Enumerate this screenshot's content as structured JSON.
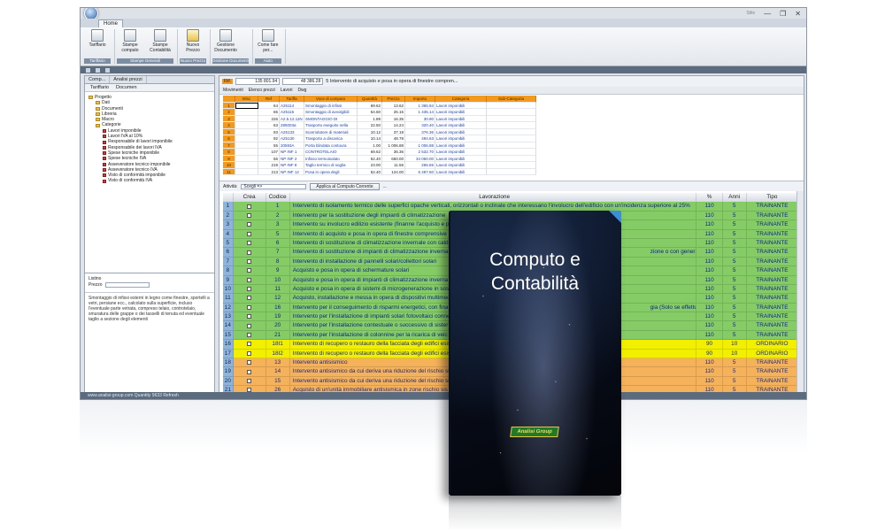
{
  "window": {
    "menu_label": "Stile",
    "minimize": "—",
    "restore": "❐",
    "close": "✕"
  },
  "ribbon": {
    "tab": "Home",
    "groups": [
      {
        "label": "Tariffario",
        "buttons": [
          "Tariffario"
        ]
      },
      {
        "label": "Stampe Generali",
        "buttons": [
          "Stampe computo",
          "Stampe Contabilità"
        ]
      },
      {
        "label": "Nuovo Prezzo",
        "buttons": [
          "Nuovo Prezzo"
        ]
      },
      {
        "label": "Gestione Documenti",
        "buttons": [
          "Gestione Documento"
        ]
      },
      {
        "label": "Aiuto",
        "buttons": [
          "Come fare per..."
        ]
      }
    ]
  },
  "left_panel": {
    "tabs": [
      "Comp...",
      "Analisi prezzi"
    ],
    "subtabs": [
      "Tariffario",
      "Documen"
    ],
    "tree": [
      {
        "label": "Progetto",
        "level": 0,
        "type": "folder"
      },
      {
        "label": "Dati",
        "level": 1,
        "type": "folder"
      },
      {
        "label": "Documenti",
        "level": 1,
        "type": "folder"
      },
      {
        "label": "Libreria",
        "level": 1,
        "type": "folder"
      },
      {
        "label": "Macro",
        "level": 1,
        "type": "folder"
      },
      {
        "label": "Categorie",
        "level": 1,
        "type": "folder"
      },
      {
        "label": "Lavori imponibile",
        "level": 2,
        "type": "cat"
      },
      {
        "label": "Lavori IVA al 10%",
        "level": 2,
        "type": "cat"
      },
      {
        "label": "Responsabile di lavori imponibile",
        "level": 2,
        "type": "cat"
      },
      {
        "label": "Responsabile dei lavori IVA",
        "level": 2,
        "type": "cat"
      },
      {
        "label": "Spese tecniche imponibile",
        "level": 2,
        "type": "cat"
      },
      {
        "label": "Spese tecniche IVA",
        "level": 2,
        "type": "cat"
      },
      {
        "label": "Asseveratore tecnico imponibile",
        "level": 2,
        "type": "cat"
      },
      {
        "label": "Asseveratore tecnico IVA",
        "level": 2,
        "type": "cat"
      },
      {
        "label": "Visto di conformità imponibile",
        "level": 2,
        "type": "cat"
      },
      {
        "label": "Visto di conformità IVA",
        "level": 2,
        "type": "cat"
      }
    ],
    "fields": {
      "listino_label": "Listino",
      "prezzo_label": "Prezzo"
    },
    "description": "Smontaggio di infissi esterni in legno come finestre, sportelli a vetri, persiane ecc., calcolato sulla superficie, incluso l'eventuale parte vetrata, compreso telaio, controtelaio, smuratura delle grappe o dei tasselli di tenuta ed eventuale taglio a sezione degli elementi"
  },
  "main": {
    "ref_label": "Rif.",
    "total1": "135 801.94",
    "total2": "48 386.28",
    "title": "5 Intervento di acquisto e posa in opera di finestre compren...",
    "subtabs": [
      "Movimenti",
      "Elenco prezzi",
      "Lavori",
      "Dwg"
    ],
    "grid1_headers": [
      "",
      "Misc",
      "Ref",
      "Tariffa",
      "Voce di computo",
      "Quantità",
      "Prezzo",
      "Importo",
      "Categoria",
      "Sub-Categoria"
    ],
    "grid1_rows": [
      [
        "1",
        "",
        "64",
        "A25114",
        "Smontaggio di infissi",
        "69.62",
        "13.62",
        "1 365.94",
        "Lavori imponibili",
        ""
      ],
      [
        "2",
        "",
        "65",
        "A25115",
        "Smontaggio di avvolgibili",
        "54.60",
        "26.16",
        "1 435.14",
        "Lavori imponibili",
        ""
      ],
      [
        "3",
        "",
        "226",
        "A2.5.12.11N",
        "SMONTAGGIO DI",
        "1.89",
        "16.35",
        "30.90",
        "Lavori imponibili",
        ""
      ],
      [
        "4",
        "",
        "63",
        "285003a",
        "Trasporto eseguito nella",
        "22.50",
        "14.24",
        "320.40",
        "Lavori imponibili",
        ""
      ],
      [
        "5",
        "",
        "93",
        "A25133",
        "Scarriolatore di materiali",
        "10.12",
        "37.19",
        "376.36",
        "Lavori imponibili",
        ""
      ],
      [
        "6",
        "",
        "92",
        "A25130",
        "Trasporto a discarica",
        "10.14",
        "48.78",
        "494.63",
        "Lavori imponibili",
        ""
      ],
      [
        "7",
        "",
        "55",
        "20593A",
        "Porta blindata contoura",
        "1.00",
        "1 006.88",
        "1 006.88",
        "Lavori imponibili",
        ""
      ],
      [
        "8",
        "",
        "107",
        "NP INF 1",
        "CONTROTELAIO",
        "69.62",
        "36.36",
        "2 532.70",
        "Lavori imponibili",
        ""
      ],
      [
        "9",
        "",
        "56",
        "NP INF 2",
        "Infisso termoisolato",
        "52.40",
        "650.00",
        "34 060.00",
        "Lavori imponibili",
        ""
      ],
      [
        "10",
        "",
        "219",
        "NP INF 8",
        "Taglio termico di soglia",
        "23.00",
        "11.55",
        "265.65",
        "Lavori imponibili",
        ""
      ],
      [
        "11",
        "",
        "213",
        "NP INF 12",
        "Posa in opera degli",
        "52.40",
        "124.00",
        "6 497.60",
        "Lavori imponibili",
        ""
      ]
    ],
    "filter": {
      "label": "Attività:",
      "select_value": "Scegli =>",
      "apply_button": "Applica al Computo Corrente",
      "more": "..."
    },
    "grid2_headers": {
      "crea": "Crea",
      "codice": "Codice",
      "lavorazione": "Lavorazione",
      "pct": "%",
      "anni": "Anni",
      "tipo": "Tipo"
    },
    "grid2_rows": [
      {
        "n": "1",
        "cod": "1",
        "lav": "Intervento di isolamento termico delle superfici opache verticali, orizzontali o inclinate che interessano l'involucro dell'edificio con un'incidenza superiore al 25%",
        "pct": "110",
        "anni": "5",
        "tipo": "TRAINANTE",
        "color": "g"
      },
      {
        "n": "2",
        "cod": "2",
        "lav": "Intervento per la sostituzione degli impianti di climatizzazione",
        "pct": "110",
        "anni": "5",
        "tipo": "TRAINANTE",
        "color": "g"
      },
      {
        "n": "3",
        "cod": "3",
        "lav": "Intervento su involucro edilizio esistente (finanne l'acquisto e p",
        "pct": "110",
        "anni": "5",
        "tipo": "TRAINANTE",
        "color": "g"
      },
      {
        "n": "4",
        "cod": "5",
        "lav": "Intervento di acquisto e posa in opera di finestre comprensive",
        "pct": "110",
        "anni": "5",
        "tipo": "TRAINANTE",
        "color": "g"
      },
      {
        "n": "5",
        "cod": "6",
        "lav": "Intervento di sostituzione di climatizzazione invernale con cald",
        "pct": "110",
        "anni": "5",
        "tipo": "TRAINANTE",
        "color": "g"
      },
      {
        "n": "6",
        "cod": "7",
        "lav": "Intervento di sostituzione di impianti di climatizzazione inverna",
        "lav2": "zione o con generatori ibrid",
        "pct": "110",
        "anni": "5",
        "tipo": "TRAINANTE",
        "color": "g"
      },
      {
        "n": "7",
        "cod": "8",
        "lav": "Intervento di installazione di pannelli solari/collettori solari",
        "pct": "110",
        "anni": "5",
        "tipo": "TRAINANTE",
        "color": "g"
      },
      {
        "n": "8",
        "cod": "9",
        "lav": "Acquisto e posa in opera di schermature solari",
        "pct": "110",
        "anni": "5",
        "tipo": "TRAINANTE",
        "color": "g"
      },
      {
        "n": "9",
        "cod": "10",
        "lav": "Acquisto e posa in opera di impianti di climatizzazione inverna",
        "pct": "110",
        "anni": "5",
        "tipo": "TRAINANTE",
        "color": "g"
      },
      {
        "n": "10",
        "cod": "11",
        "lav": "Acquisto e posa in opera di sistemi di microgenerazione in sost",
        "pct": "110",
        "anni": "5",
        "tipo": "TRAINANTE",
        "color": "g"
      },
      {
        "n": "11",
        "cod": "12",
        "lav": "Acquisto, installazione e messa in opera di dispositivi multimed",
        "pct": "110",
        "anni": "5",
        "tipo": "TRAINANTE",
        "color": "g"
      },
      {
        "n": "12",
        "cod": "16",
        "lav": "Intervento per il conseguimento di risparmi energetici, con finali",
        "lav2": "gia (Solo se effettuato da co",
        "pct": "110",
        "anni": "5",
        "tipo": "TRAINANTE",
        "color": "g"
      },
      {
        "n": "13",
        "cod": "19",
        "lav": "Intervento per l'installazione di impianti solari fotovoltaici conne",
        "pct": "110",
        "anni": "5",
        "tipo": "TRAINANTE",
        "color": "g"
      },
      {
        "n": "14",
        "cod": "20",
        "lav": "Intervento per l'installazione contestuale o successivo di sister",
        "pct": "110",
        "anni": "5",
        "tipo": "TRAINANTE",
        "color": "g"
      },
      {
        "n": "15",
        "cod": "21",
        "lav": "Intervento per l'installazione di colonnine per la ricarica di veic",
        "pct": "110",
        "anni": "5",
        "tipo": "TRAINANTE",
        "color": "g"
      },
      {
        "n": "16",
        "cod": "18I1",
        "lav": "Intervento di recupero o restauro della facciata degli edifici esist",
        "pct": "90",
        "anni": "10",
        "tipo": "ORDINARIO",
        "color": "y"
      },
      {
        "n": "17",
        "cod": "18I2",
        "lav": "Intervento di recupero o restauro della facciata degli edifici esist",
        "pct": "90",
        "anni": "10",
        "tipo": "ORDINARIO",
        "color": "y"
      },
      {
        "n": "18",
        "cod": "13",
        "lav": "Intervento antisismico",
        "pct": "110",
        "anni": "5",
        "tipo": "TRAINANTE",
        "color": "o"
      },
      {
        "n": "19",
        "cod": "14",
        "lav": "Intervento antisismico da cui deriva una riduzione del rischio sis",
        "pct": "110",
        "anni": "5",
        "tipo": "TRAINANTE",
        "color": "o"
      },
      {
        "n": "20",
        "cod": "15",
        "lav": "Intervento antisismico da cui deriva una riduzione del rischio sis",
        "pct": "110",
        "anni": "5",
        "tipo": "TRAINANTE",
        "color": "o"
      },
      {
        "n": "21",
        "cod": "26",
        "lav": "Acquisto di un'unità immobiliare antisismica in zone  rischio sis",
        "pct": "110",
        "anni": "5",
        "tipo": "TRAINANTE",
        "color": "o"
      },
      {
        "n": "22",
        "cod": "27",
        "lav": "Acquisto di un'unità immobiliare antisismica in zone  rischio sis",
        "pct": "110",
        "anni": "5",
        "tipo": "TRAINANTE",
        "color": "o"
      }
    ]
  },
  "status": {
    "text": "www.analisi-group.com   Quantity 9633   Refresh"
  },
  "box": {
    "title_line1": "Computo e",
    "title_line2": "Contabilità",
    "brand": "Analisi Group"
  },
  "colors": {
    "green_row": "#86cc66",
    "yellow_row": "#f2f000",
    "orange_row": "#f6b25a",
    "header_orange": "#f29a1f",
    "row_number_blue": "#8fb3d9"
  }
}
